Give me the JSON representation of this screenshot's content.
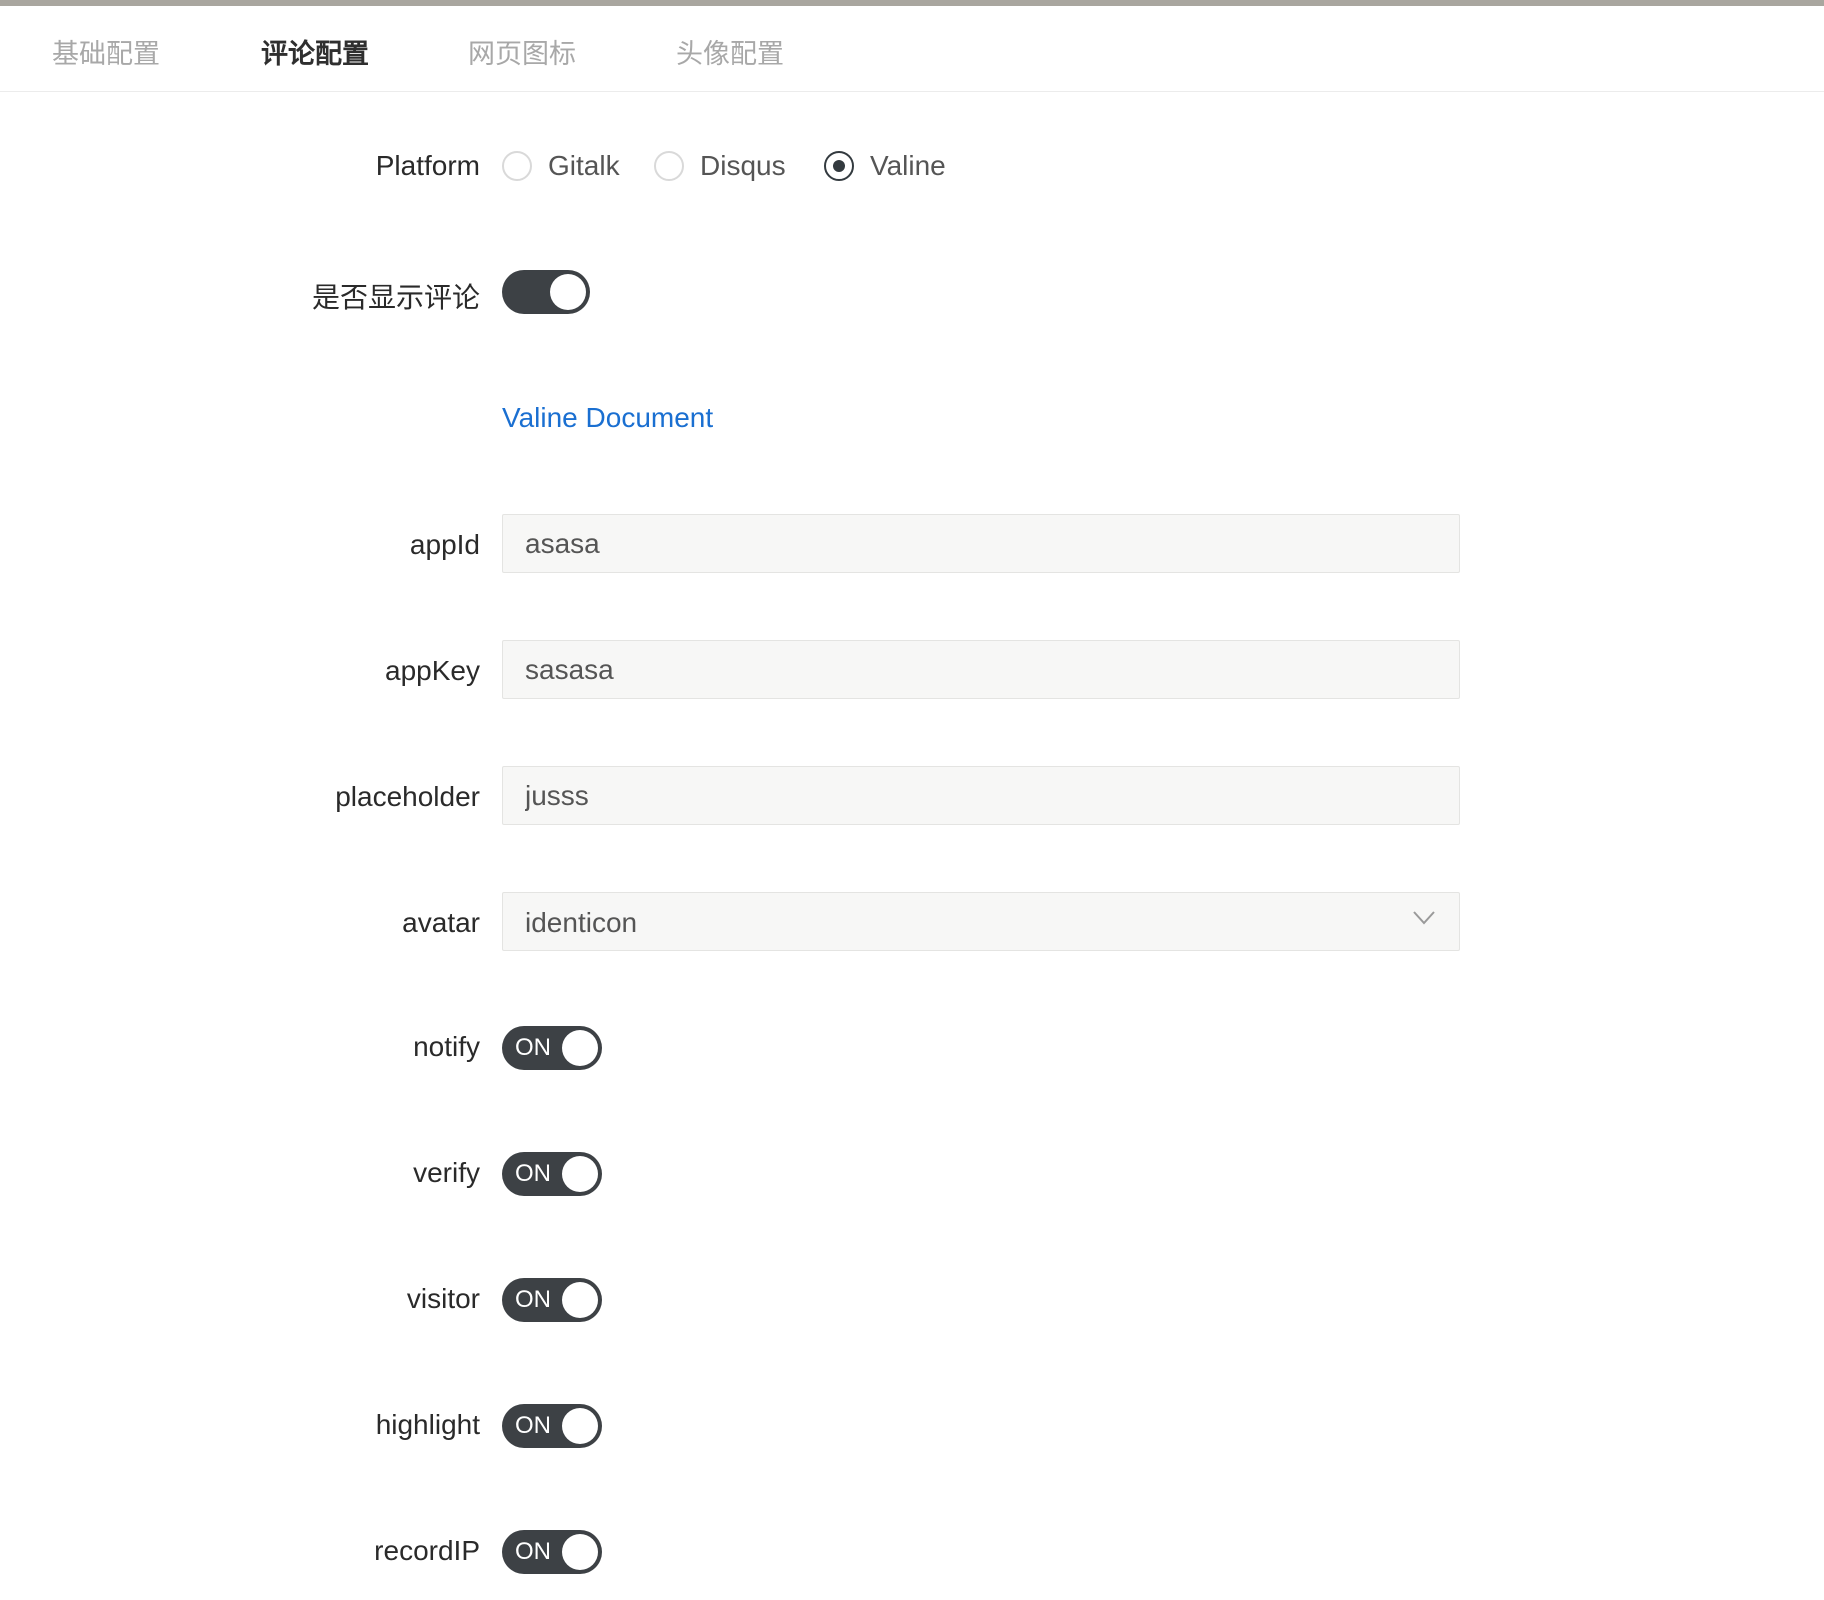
{
  "tabs": [
    {
      "label": "基础配置",
      "active": false
    },
    {
      "label": "评论配置",
      "active": true
    },
    {
      "label": "网页图标",
      "active": false
    },
    {
      "label": "头像配置",
      "active": false
    }
  ],
  "platform": {
    "label": "Platform",
    "options": [
      "Gitalk",
      "Disqus",
      "Valine"
    ],
    "selected": "Valine"
  },
  "show_comments": {
    "label": "是否显示评论",
    "enabled": true
  },
  "doc_link": {
    "label": "Valine Document"
  },
  "fields": {
    "appId": {
      "label": "appId",
      "value": "asasa"
    },
    "appKey": {
      "label": "appKey",
      "value": "sasasa"
    },
    "placeholder": {
      "label": "placeholder",
      "value": "jusss"
    }
  },
  "avatar": {
    "label": "avatar",
    "value": "identicon",
    "icon": "chevron-down-icon"
  },
  "toggles": [
    {
      "key": "notify",
      "label": "notify",
      "state": "ON"
    },
    {
      "key": "verify",
      "label": "verify",
      "state": "ON"
    },
    {
      "key": "visitor",
      "label": "visitor",
      "state": "ON"
    },
    {
      "key": "highlight",
      "label": "highlight",
      "state": "ON"
    },
    {
      "key": "recordIP",
      "label": "recordIP",
      "state": "ON"
    }
  ],
  "colors": {
    "switch_on": "#3d4145",
    "link": "#1a6fd1",
    "active_tab": "#2f2f2f",
    "inactive_tab": "#a8a8a8"
  }
}
